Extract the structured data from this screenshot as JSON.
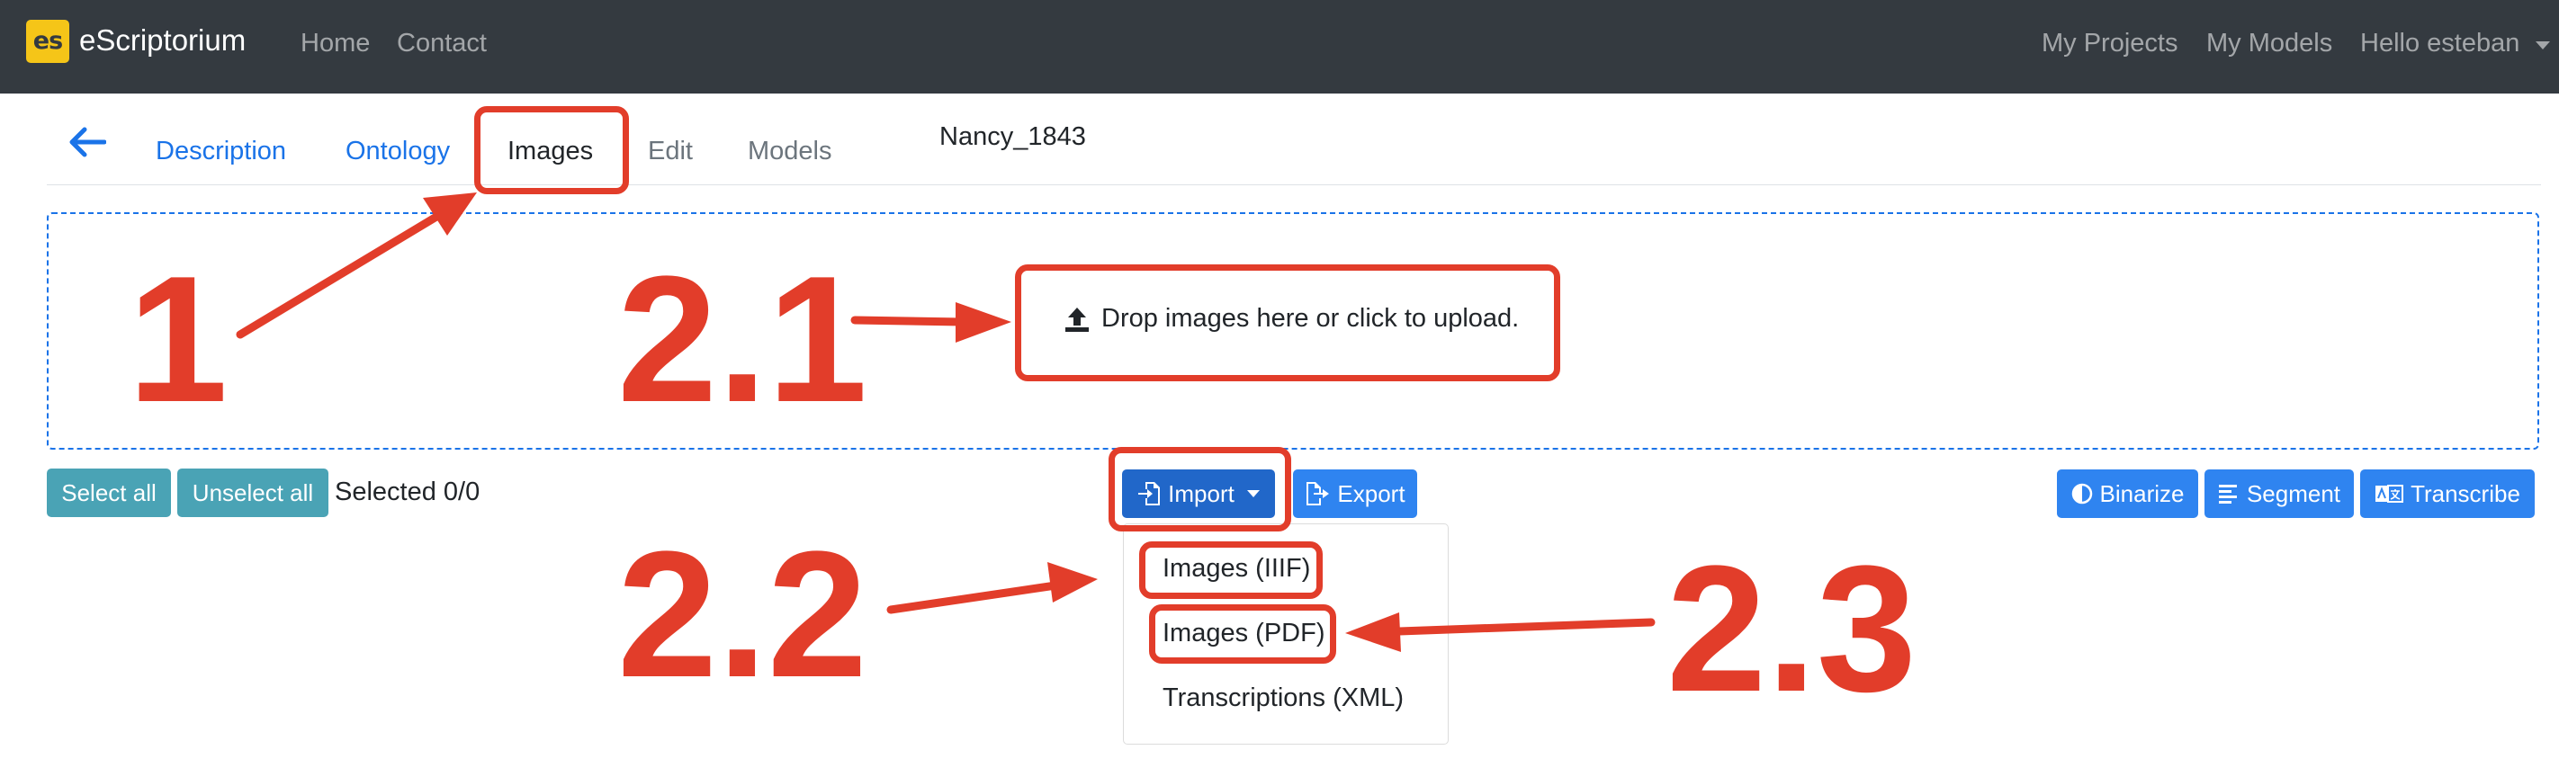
{
  "navbar": {
    "logo_text": "es",
    "brand": "eScriptorium",
    "links": [
      "Home",
      "Contact"
    ],
    "right_links": [
      "My Projects",
      "My Models",
      "Hello esteban"
    ]
  },
  "tabs": {
    "items": [
      "Description",
      "Ontology",
      "Images",
      "Edit",
      "Models"
    ],
    "active": "Images",
    "document_title": "Nancy_1843"
  },
  "dropzone": {
    "message": "Drop images here or click to upload."
  },
  "toolbar": {
    "select_all": "Select all",
    "unselect_all": "Unselect all",
    "selected_text": "Selected 0/0",
    "import": "Import",
    "export": "Export",
    "binarize": "Binarize",
    "segment": "Segment",
    "transcribe": "Transcribe"
  },
  "import_menu": {
    "items": [
      "Images (IIIF)",
      "Images (PDF)",
      "Transcriptions (XML)"
    ]
  },
  "annotations": {
    "labels": [
      "1",
      "2.1",
      "2.2",
      "2.3"
    ],
    "color": "#e23d2a"
  },
  "colors": {
    "navbar_bg": "#343a40",
    "link_blue": "#1a73e8",
    "info_button": "#4aa3b5",
    "primary_button": "#2f84f0",
    "annotation_red": "#e23d2a",
    "logo_yellow": "#f5c518"
  }
}
